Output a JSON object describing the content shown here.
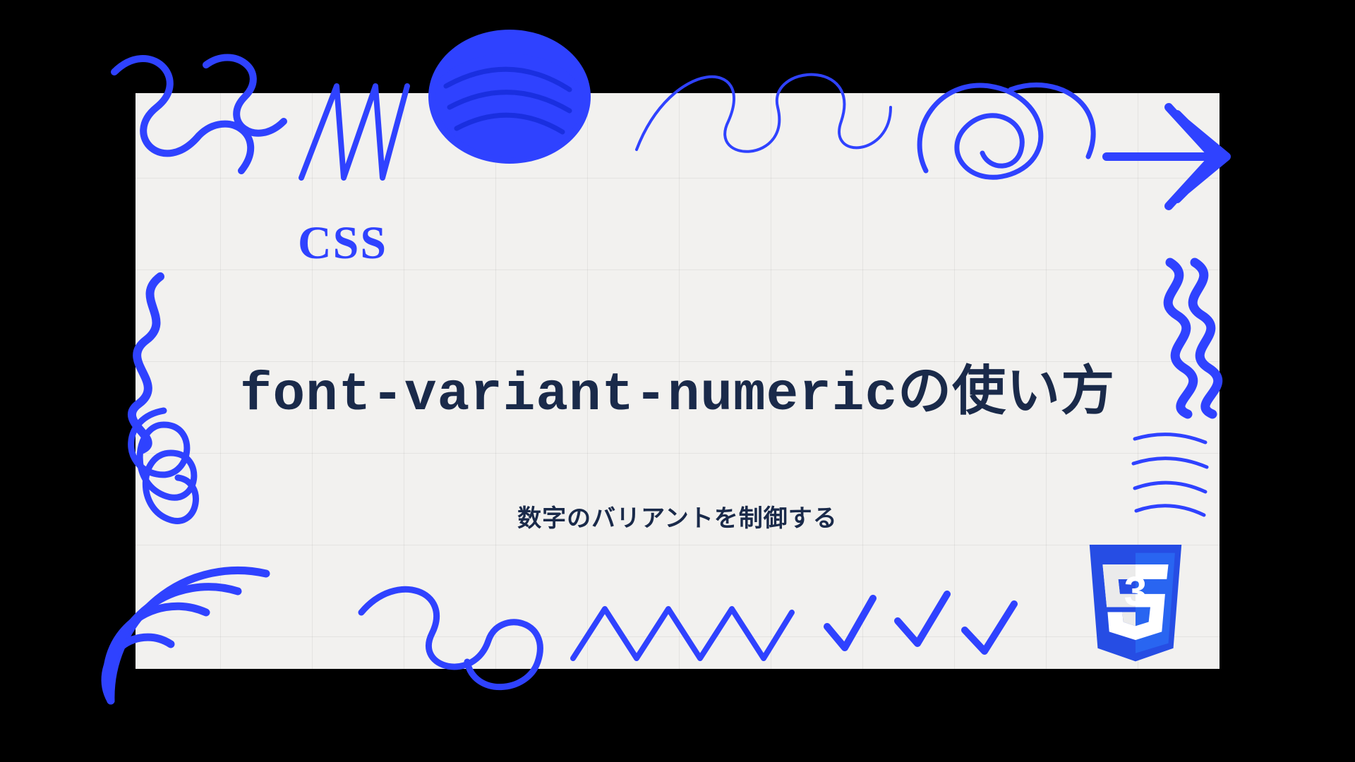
{
  "category": "CSS",
  "title": "font-variant-numericの使い方",
  "subtitle": "数字のバリアントを制御する",
  "colors": {
    "accent": "#2f42ff",
    "text": "#1a2a4a",
    "bg": "#f2f1ef"
  },
  "logo": {
    "name": "css3-shield-icon",
    "glyph": "3"
  }
}
